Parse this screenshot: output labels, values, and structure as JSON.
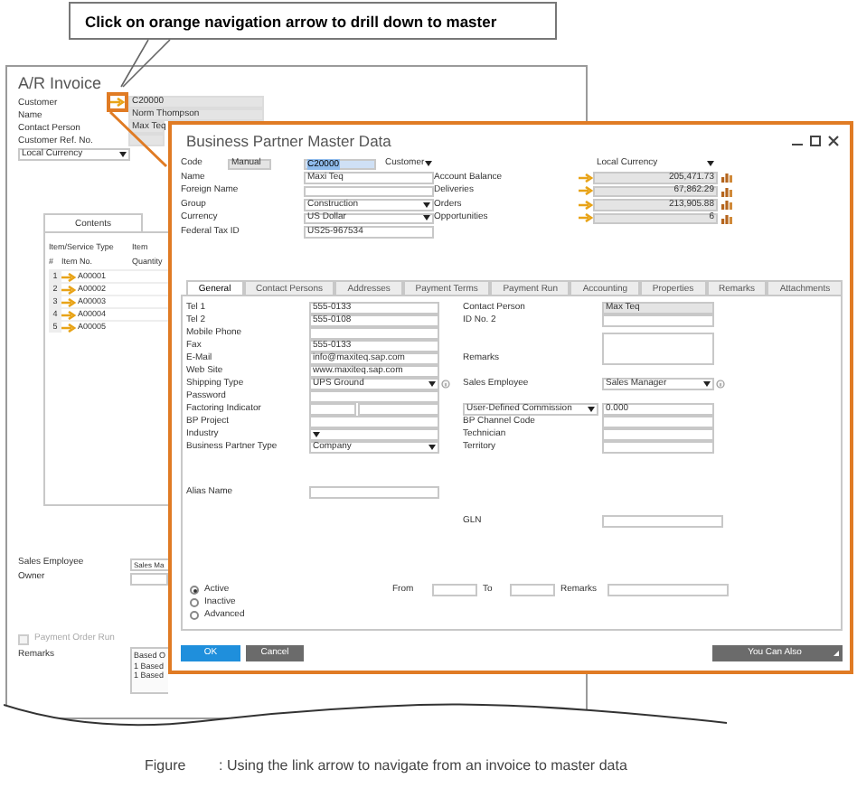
{
  "callout": {
    "text": "Click on orange navigation arrow to drill down to master"
  },
  "invoice": {
    "title": "A/R Invoice",
    "fields": [
      {
        "label": "Customer",
        "value": "C20000",
        "link_arrow": true,
        "highlighted": true
      },
      {
        "label": "Name",
        "value": "Norm Thompson",
        "link_arrow": false
      },
      {
        "label": "Contact Person",
        "value": "Max Teq",
        "link_arrow": false
      },
      {
        "label": "Customer Ref. No.",
        "link_arrow": false
      }
    ],
    "currency": "Local Currency",
    "tabs": [
      {
        "label": "Contents",
        "selected": true
      }
    ],
    "table": {
      "group_headers": [
        "Item/Service Type",
        "Item"
      ],
      "columns": [
        "#",
        "Item No.",
        "Quantity"
      ],
      "rows": [
        {
          "index": "1",
          "item_no": "A00001"
        },
        {
          "index": "2",
          "item_no": "A00002"
        },
        {
          "index": "3",
          "item_no": "A00003"
        },
        {
          "index": "4",
          "item_no": "A00004"
        },
        {
          "index": "5",
          "item_no": "A00005"
        }
      ]
    },
    "sales_employee": {
      "label": "Sales Employee",
      "value": "Sales Ma"
    },
    "owner": {
      "label": "Owner"
    },
    "payment_order_run": {
      "label": "Payment Order Run",
      "checked": false,
      "disabled": true
    },
    "remarks": {
      "label": "Remarks",
      "lines": [
        "Based O",
        "1 Based",
        "1 Based"
      ]
    }
  },
  "bp": {
    "title": "Business Partner Master Data",
    "code": {
      "label": "Code",
      "series": "Manual",
      "value": "C20000",
      "type": "Customer"
    },
    "header_fields": [
      {
        "label": "Name",
        "value": "Maxi Teq",
        "kind": "text"
      },
      {
        "label": "Foreign Name",
        "kind": "text"
      },
      {
        "label": "Group",
        "value": "Construction",
        "kind": "dropdown"
      },
      {
        "label": "Currency",
        "value": "US Dollar",
        "kind": "dropdown"
      },
      {
        "label": "Federal Tax ID",
        "value": "US25-967534",
        "kind": "text"
      }
    ],
    "currency_view": "Local Currency",
    "balances": [
      {
        "label": "Account Balance",
        "value": "205,471.73"
      },
      {
        "label": "Deliveries",
        "value": "67,862.29"
      },
      {
        "label": "Orders",
        "value": "213,905.88"
      },
      {
        "label": "Opportunities",
        "value": "6"
      }
    ],
    "tabs": [
      {
        "label": "General",
        "selected": true
      },
      {
        "label": "Contact Persons",
        "selected": false
      },
      {
        "label": "Addresses",
        "selected": false
      },
      {
        "label": "Payment Terms",
        "selected": false
      },
      {
        "label": "Payment Run",
        "selected": false
      },
      {
        "label": "Accounting",
        "selected": false
      },
      {
        "label": "Properties",
        "selected": false
      },
      {
        "label": "Remarks",
        "selected": false
      },
      {
        "label": "Attachments",
        "selected": false
      }
    ],
    "general_rows": [
      {
        "left": {
          "label": "Tel 1",
          "value": "555-0133",
          "kind": "text"
        },
        "right": {
          "label": "Contact Person",
          "value": "Max Teq",
          "kind": "readonly"
        }
      },
      {
        "left": {
          "label": "Tel 2",
          "value": "555-0108",
          "kind": "text"
        },
        "right": {
          "label": "ID No. 2",
          "kind": "text"
        }
      },
      {
        "left": {
          "label": "Mobile Phone",
          "kind": "text"
        }
      },
      {
        "left": {
          "label": "Fax",
          "value": "555-0133",
          "kind": "text"
        }
      },
      {
        "left": {
          "label": "E-Mail",
          "value": "info@maxiteq.sap.com",
          "kind": "text"
        },
        "right": {
          "label": "Remarks",
          "kind": "textarea"
        }
      },
      {
        "left": {
          "label": "Web Site",
          "value": "www.maxiteq.sap.com",
          "kind": "text"
        }
      },
      {
        "left": {
          "label": "Shipping Type",
          "value": "UPS Ground",
          "kind": "dropdown",
          "info_button": true
        },
        "right": {
          "label": "Sales Employee",
          "value": "Sales Manager",
          "kind": "dropdown",
          "info_button": true
        }
      },
      {
        "left": {
          "label": "Password",
          "kind": "text"
        }
      },
      {
        "left": {
          "label": "Factoring Indicator",
          "kind": "split"
        },
        "right": {
          "label": "User-Defined Commission",
          "value": "0.000",
          "kind": "dropdown_label"
        }
      },
      {
        "left": {
          "label": "BP Project",
          "kind": "text"
        },
        "right": {
          "label": "BP Channel Code",
          "kind": "text"
        }
      },
      {
        "left": {
          "label": "Industry",
          "kind": "dropdown",
          "info_button": false
        },
        "right": {
          "label": "Technician",
          "kind": "text"
        }
      },
      {
        "left": {
          "label": "Business Partner Type",
          "value": "Company",
          "kind": "dropdown",
          "info_button": false
        },
        "right": {
          "label": "Territory",
          "kind": "text"
        }
      }
    ],
    "alias_name": {
      "label": "Alias Name"
    },
    "gln": {
      "label": "GLN"
    },
    "status": [
      {
        "label": "Active",
        "selected": true
      },
      {
        "label": "Inactive",
        "selected": false
      },
      {
        "label": "Advanced",
        "selected": false
      }
    ],
    "period": {
      "from_label": "From",
      "to_label": "To",
      "remarks_label": "Remarks"
    },
    "buttons": [
      {
        "label": "OK",
        "kind": "primary"
      },
      {
        "label": "Cancel",
        "kind": "secondary"
      },
      {
        "label": "You Can Also",
        "kind": "menu"
      }
    ]
  },
  "caption": {
    "label": "Figure",
    "text": ": Using the link arrow to navigate from an invoice to master data"
  }
}
